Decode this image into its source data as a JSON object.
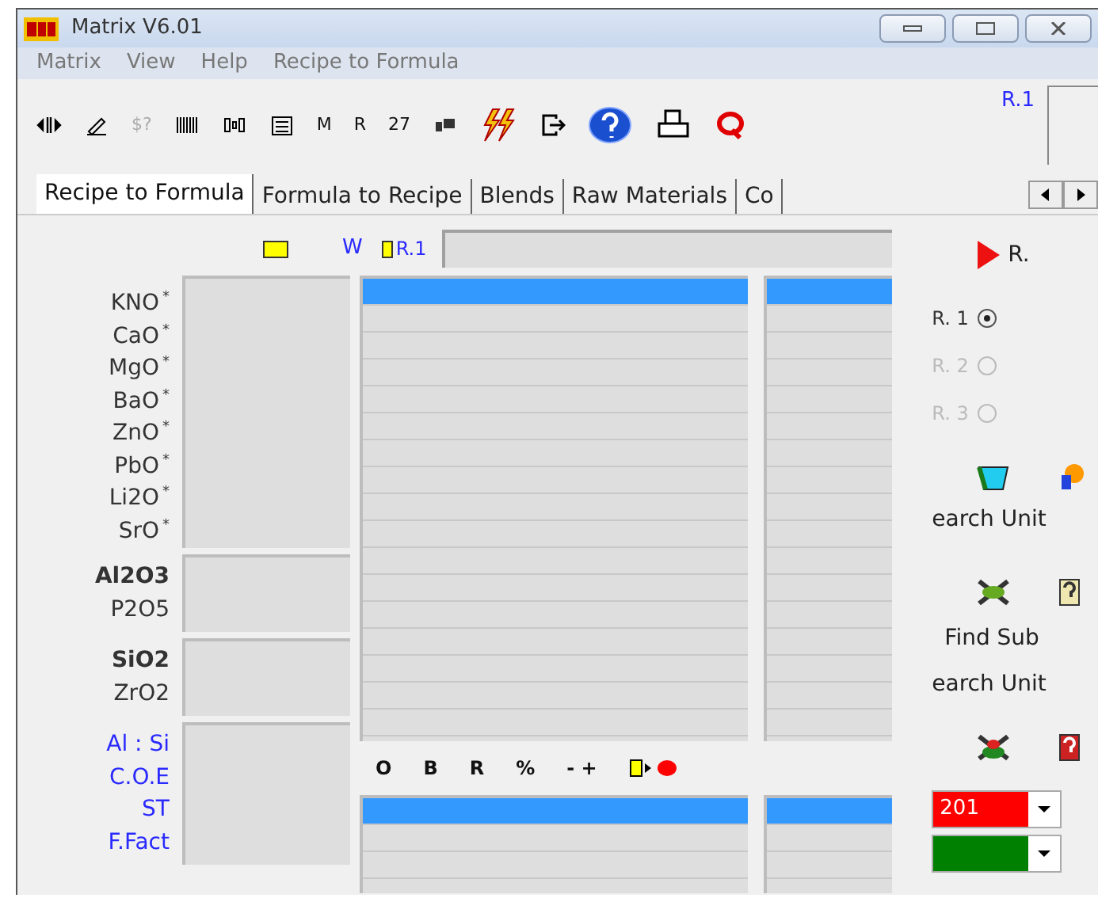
{
  "window": {
    "title": "Matrix V6.01"
  },
  "menu": [
    "Matrix",
    "View",
    "Help",
    "Recipe to Formula"
  ],
  "toolbar": [
    {
      "kind": "icon"
    },
    {
      "kind": "icon"
    },
    {
      "kind": "text",
      "label": "$?",
      "disabled": true
    },
    {
      "kind": "icon"
    },
    {
      "kind": "icon"
    },
    {
      "kind": "icon"
    },
    {
      "kind": "text",
      "label": "M",
      "disabled": false
    },
    {
      "kind": "text",
      "label": "R",
      "disabled": false
    },
    {
      "kind": "text",
      "label": "27",
      "disabled": false
    },
    {
      "kind": "icon"
    },
    {
      "kind": "icon"
    },
    {
      "kind": "icon"
    },
    {
      "kind": "icon"
    },
    {
      "kind": "icon"
    },
    {
      "kind": "icon"
    }
  ],
  "toolbar_recipe": {
    "label": "R.1"
  },
  "tabs": [
    {
      "label": "Recipe to Formula",
      "selected": true
    },
    {
      "label": "Formula to Recipe",
      "selected": false
    },
    {
      "label": "Blends",
      "selected": false
    },
    {
      "label": "Raw Materials",
      "selected": false
    },
    {
      "label": "Co",
      "selected": false
    }
  ],
  "header": {
    "weight_label": "W",
    "recipe_label": "R.1"
  },
  "oxide_groups": [
    {
      "items": [
        {
          "label": "KNO",
          "mark": "*",
          "bold": false
        },
        {
          "label": "CaO",
          "mark": "*",
          "bold": false
        },
        {
          "label": "MgO",
          "mark": "*",
          "bold": false
        },
        {
          "label": "BaO",
          "mark": "*",
          "bold": false
        },
        {
          "label": "ZnO",
          "mark": "*",
          "bold": false
        },
        {
          "label": "PbO",
          "mark": "*",
          "bold": false
        },
        {
          "label": "Li2O",
          "mark": "*",
          "bold": false
        },
        {
          "label": "SrO",
          "mark": "*",
          "bold": false
        }
      ]
    },
    {
      "items": [
        {
          "label": "Al2O3",
          "bold": true
        },
        {
          "label": "P2O5",
          "bold": false
        }
      ]
    },
    {
      "items": [
        {
          "label": "SiO2",
          "bold": true
        },
        {
          "label": "ZrO2",
          "bold": false
        }
      ]
    },
    {
      "items": [
        {
          "label": "Al : Si",
          "bold": false
        },
        {
          "label": "C.O.E",
          "bold": false
        },
        {
          "label": "ST",
          "bold": false
        },
        {
          "label": "F.Fact",
          "bold": false
        }
      ],
      "blue": true
    }
  ],
  "grid": {
    "rows": [
      {
        "selected": true
      },
      {
        "selected": false
      },
      {
        "selected": false
      },
      {
        "selected": false
      },
      {
        "selected": false
      },
      {
        "selected": false
      },
      {
        "selected": false
      },
      {
        "selected": false
      },
      {
        "selected": false
      },
      {
        "selected": false
      },
      {
        "selected": false
      },
      {
        "selected": false
      },
      {
        "selected": false
      },
      {
        "selected": false
      },
      {
        "selected": false
      },
      {
        "selected": false
      },
      {
        "selected": false
      }
    ]
  },
  "grid_toolbar": [
    {
      "kind": "text",
      "label": "O"
    },
    {
      "kind": "text",
      "label": "B"
    },
    {
      "kind": "text",
      "label": "R"
    },
    {
      "kind": "text",
      "label": "%"
    },
    {
      "kind": "text",
      "label": "- +"
    },
    {
      "kind": "icon"
    }
  ],
  "lower_grid": {
    "rows": [
      {
        "selected": true
      },
      {
        "selected": false
      },
      {
        "selected": false
      }
    ]
  },
  "right_panel": {
    "run_label": "R.",
    "recipes": [
      {
        "label": "R. 1",
        "selected": true,
        "disabled": false
      },
      {
        "label": "R. 2",
        "selected": false,
        "disabled": true
      },
      {
        "label": "R. 3",
        "selected": false,
        "disabled": true
      }
    ],
    "labels": [
      "earch Unit",
      "Find Sub",
      "earch Unit"
    ],
    "combos": [
      {
        "value": "201",
        "color": "#ff0000"
      },
      {
        "color": "#008000"
      }
    ]
  }
}
